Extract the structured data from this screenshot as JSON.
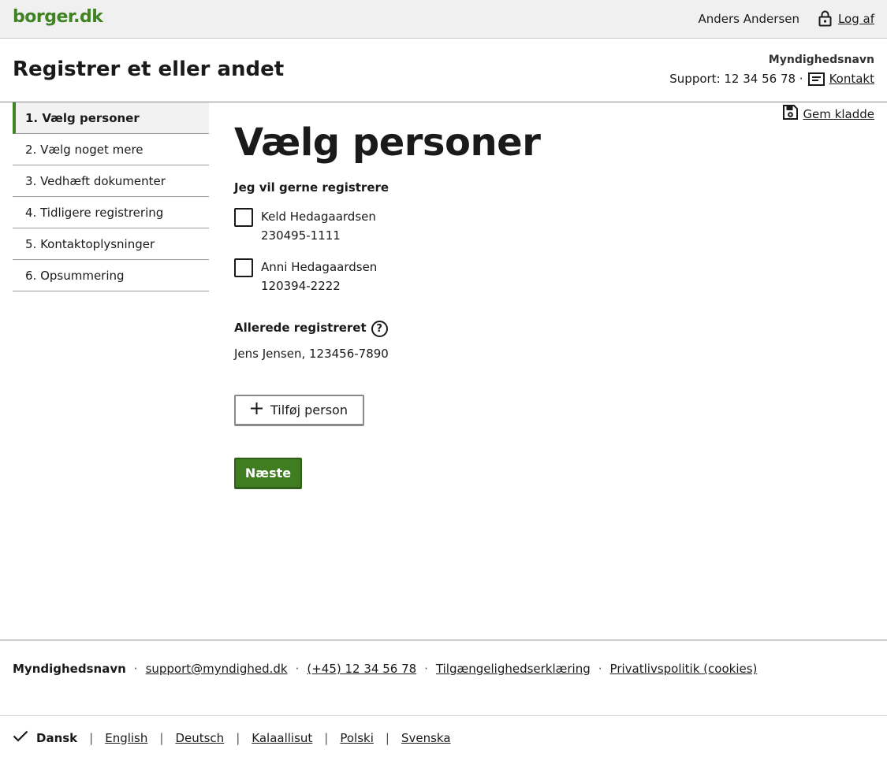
{
  "topbar": {
    "logo": "borger.dk",
    "user_name": "Anders Andersen",
    "logout_label": "Log af",
    "logout_icon": "lock-icon"
  },
  "header": {
    "title": "Registrer et eller andet",
    "authority": "Myndighedsnavn",
    "support_text": "Support: 12 34 56 78 ·",
    "contact_label": "Kontakt",
    "contact_icon": "message-icon"
  },
  "sidebar": {
    "items": [
      {
        "label": "1. Vælg personer",
        "active": true
      },
      {
        "label": "2. Vælg noget mere",
        "active": false
      },
      {
        "label": "3. Vedhæft dokumenter",
        "active": false
      },
      {
        "label": "4. Tidligere registrering",
        "active": false
      },
      {
        "label": "5. Kontaktoplysninger",
        "active": false
      },
      {
        "label": "6. Opsummering",
        "active": false
      }
    ],
    "accent_color": "#3f8323"
  },
  "save_draft": {
    "label": "Gem kladde",
    "icon": "floppy-disk-icon"
  },
  "main": {
    "heading": "Vælg personer",
    "field_label": "Jeg vil gerne registrere",
    "persons": [
      {
        "name": "Keld Hedagaardsen",
        "cpr": "230495-1111",
        "checked": false
      },
      {
        "name": "Anni Hedagaardsen",
        "cpr": "120394-2222",
        "checked": false
      }
    ],
    "already_label": "Allerede registreret",
    "help_icon": "question-icon",
    "already_value": "Jens Jensen, 123456-7890",
    "add_person_label": "Tilføj person",
    "next_label": "Næste",
    "primary_color": "#3f7d20"
  },
  "footer": {
    "authority": "Myndighedsnavn",
    "email": "support@myndighed.dk",
    "phone": "(+45) 12 34 56 78",
    "accessibility": "Tilgængelighedserklæring",
    "privacy": "Privatlivspolitik (cookies)",
    "separator": "·"
  },
  "languages": {
    "current": "Dansk",
    "others": [
      "English",
      "Deutsch",
      "Kalaallisut",
      "Polski",
      "Svenska"
    ],
    "separator": "|"
  }
}
